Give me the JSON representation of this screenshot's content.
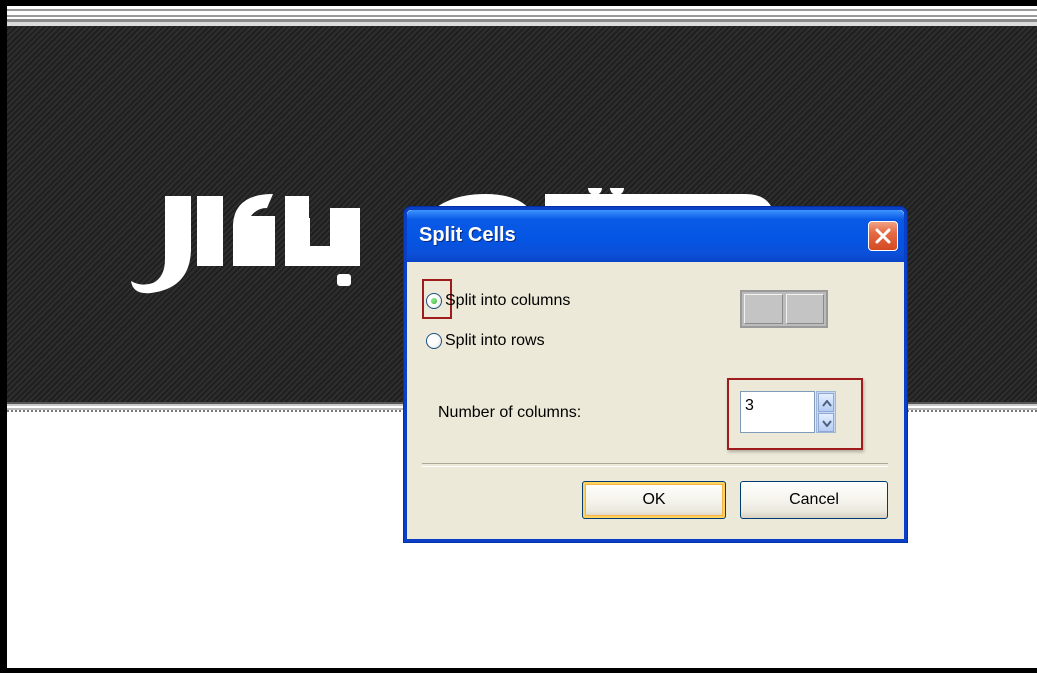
{
  "banner": {
    "logo_text": "بلال محمد"
  },
  "dialog": {
    "title": "Split Cells",
    "close_label": "×",
    "options": [
      {
        "label": "Split into columns",
        "checked": true
      },
      {
        "label": "Split into rows",
        "checked": false
      }
    ],
    "count_label": "Number of columns:",
    "count_value": "3",
    "ok_label": "OK",
    "cancel_label": "Cancel"
  },
  "colors": {
    "titlebar": "#0455e3",
    "close": "#d44a22",
    "highlight": "#a01c1c",
    "dialog_bg": "#ece9d8"
  }
}
